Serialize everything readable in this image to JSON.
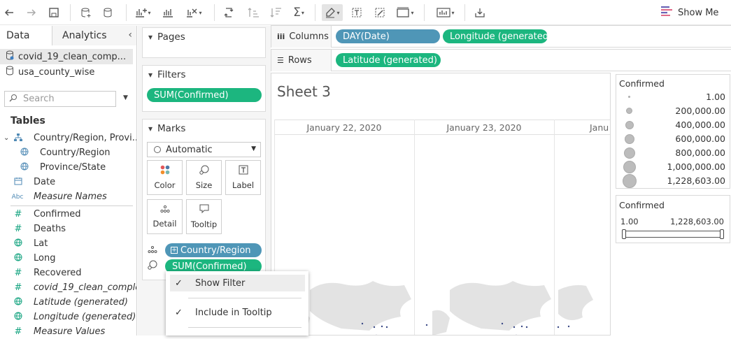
{
  "toolbar": {
    "show_me": "Show Me"
  },
  "data_pane": {
    "tabs": {
      "data": "Data",
      "analytics": "Analytics"
    },
    "sources": [
      "covid_19_clean_comp...",
      "usa_county_wise"
    ],
    "search_placeholder": "Search",
    "tables_header": "Tables",
    "fields": [
      {
        "label": "Country/Region, Provi...",
        "icon": "hierarchy-icon",
        "role": "dim",
        "italic": false
      },
      {
        "label": "Country/Region",
        "icon": "globe-icon",
        "role": "dim",
        "italic": false
      },
      {
        "label": "Province/State",
        "icon": "globe-icon",
        "role": "dim",
        "italic": false
      },
      {
        "label": "Date",
        "icon": "calendar-icon",
        "role": "dim",
        "italic": false
      },
      {
        "label": "Measure Names",
        "icon": "abc-icon",
        "role": "dim",
        "italic": true
      },
      {
        "label": "Confirmed",
        "icon": "hash-icon",
        "role": "meas",
        "italic": false
      },
      {
        "label": "Deaths",
        "icon": "hash-icon",
        "role": "meas",
        "italic": false
      },
      {
        "label": "Lat",
        "icon": "globe-icon",
        "role": "meas",
        "italic": false
      },
      {
        "label": "Long",
        "icon": "globe-icon",
        "role": "meas",
        "italic": false
      },
      {
        "label": "Recovered",
        "icon": "hash-icon",
        "role": "meas",
        "italic": false
      },
      {
        "label": "covid_19_clean_comple...",
        "icon": "hash-icon",
        "role": "meas",
        "italic": true
      },
      {
        "label": "Latitude (generated)",
        "icon": "globe-icon",
        "role": "meas",
        "italic": true
      },
      {
        "label": "Longitude (generated)",
        "icon": "globe-icon",
        "role": "meas",
        "italic": true
      },
      {
        "label": "Measure Values",
        "icon": "hash-icon",
        "role": "meas",
        "italic": true
      }
    ]
  },
  "cards": {
    "pages": "Pages",
    "filters": "Filters",
    "filter_pill": "SUM(Confirmed)",
    "marks": "Marks",
    "mark_type": "Automatic",
    "mark_buttons": [
      "Color",
      "Size",
      "Label",
      "Detail",
      "Tooltip"
    ],
    "mark_pills": [
      "Country/Region",
      "SUM(Confirmed)"
    ]
  },
  "columns": {
    "label": "Columns",
    "pills": [
      "DAY(Date)",
      "Longitude (generated)"
    ]
  },
  "rows": {
    "label": "Rows",
    "pills": [
      "Latitude (generated)"
    ]
  },
  "view": {
    "title": "Sheet 3",
    "col_headers": [
      "January 22, 2020",
      "January 23, 2020",
      "Janu"
    ]
  },
  "size_legend": {
    "title": "Confirmed",
    "items": [
      "1.00",
      "200,000.00",
      "400,000.00",
      "600,000.00",
      "800,000.00",
      "1,000,000.00",
      "1,228,603.00"
    ]
  },
  "filter_card": {
    "title": "Confirmed",
    "min": "1.00",
    "max": "1,228,603.00"
  },
  "context_menu": {
    "items": [
      "Show Filter",
      "Include in Tooltip"
    ]
  },
  "colors": {
    "measure_pill": "#1cb67f",
    "dimension_pill": "#4f96b7",
    "dim_icon": "#4f8ab5",
    "meas_icon": "#13a37f"
  }
}
